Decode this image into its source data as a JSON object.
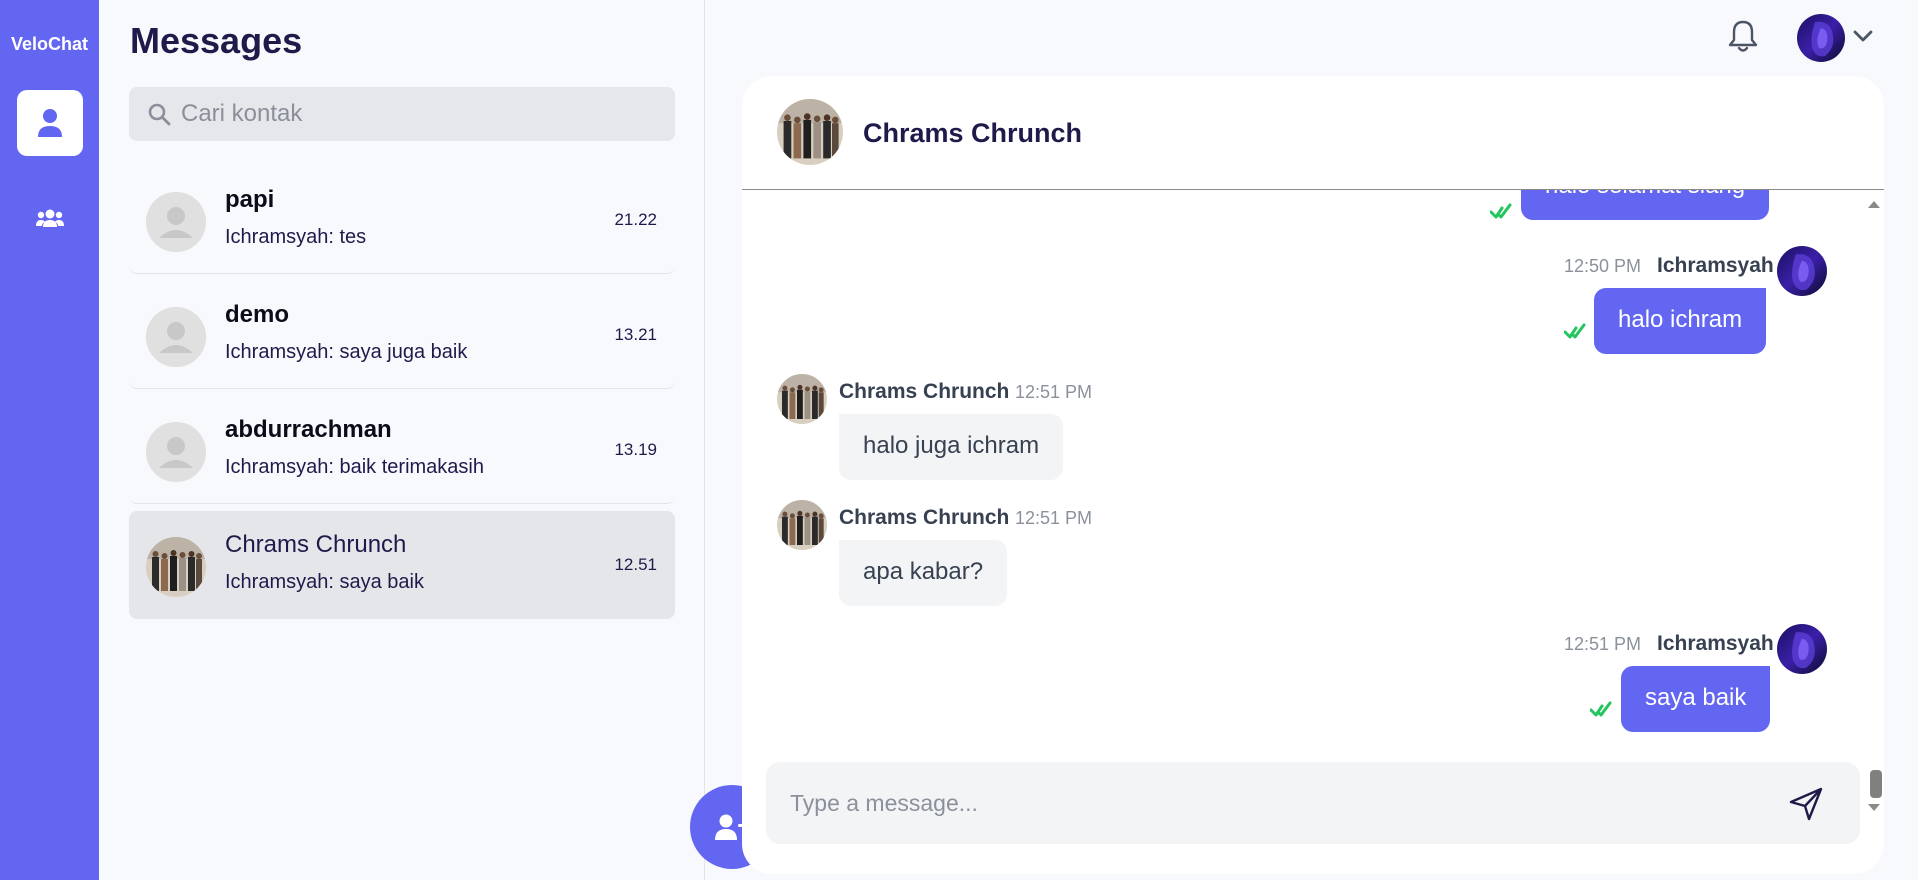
{
  "app": {
    "brand": "VeloChat"
  },
  "rail": {
    "items": [
      {
        "icon": "user-icon",
        "active": true
      },
      {
        "icon": "users-icon",
        "active": false
      }
    ]
  },
  "contacts_panel": {
    "title": "Messages",
    "search_placeholder": "Cari kontak",
    "contacts": [
      {
        "name": "papi",
        "last_message": "Ichramsyah: tes",
        "time": "21.22",
        "avatar": "default"
      },
      {
        "name": "demo",
        "last_message": "Ichramsyah: saya juga baik",
        "time": "13.21",
        "avatar": "default"
      },
      {
        "name": "abdurrachman",
        "last_message": "Ichramsyah: baik terimakasih",
        "time": "13.19",
        "avatar": "default"
      },
      {
        "name": "Chrams Chrunch",
        "last_message": "Ichramsyah: saya baik",
        "time": "12.51",
        "avatar": "group-photo",
        "active": true
      }
    ]
  },
  "chat": {
    "contact_name": "Chrams Chrunch",
    "messages": [
      {
        "direction": "out",
        "text": "halo selamat siang",
        "status": "read"
      },
      {
        "direction": "out",
        "sender": "Ichramsyah",
        "time": "12:50 PM",
        "text": "halo ichram",
        "status": "read"
      },
      {
        "direction": "in",
        "sender": "Chrams Chrunch",
        "time": "12:51 PM",
        "text": "halo juga ichram"
      },
      {
        "direction": "in",
        "sender": "Chrams Chrunch",
        "time": "12:51 PM",
        "text": "apa kabar?"
      },
      {
        "direction": "out",
        "sender": "Ichramsyah",
        "time": "12:51 PM",
        "text": "saya baik",
        "status": "read"
      }
    ],
    "composer_placeholder": "Type a message..."
  },
  "colors": {
    "accent": "#6366f1",
    "title": "#1e1b4b",
    "read_tick": "#22c55e",
    "incoming_bubble": "#f3f4f6",
    "rail": "#6366f1"
  }
}
